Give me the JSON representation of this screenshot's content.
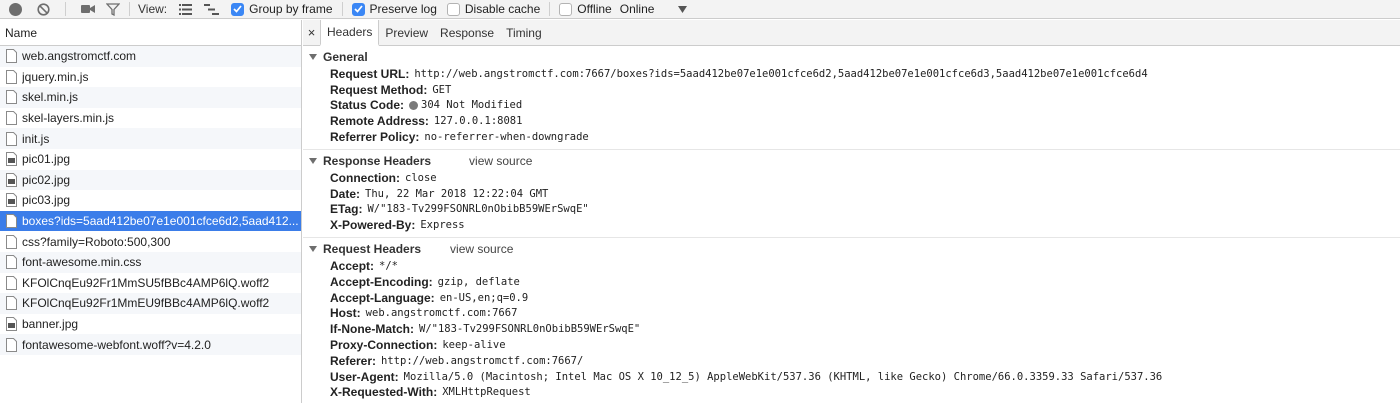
{
  "toolbar": {
    "view_label": "View:",
    "group_by_frame": {
      "label": "Group by frame",
      "checked": true
    },
    "preserve_log": {
      "label": "Preserve log",
      "checked": true
    },
    "disable_cache": {
      "label": "Disable cache",
      "checked": false
    },
    "offline": {
      "label": "Offline",
      "checked": false
    },
    "throttle_value": "Online",
    "icons": [
      "record-icon",
      "clear-icon",
      "camera-icon",
      "filter-icon",
      "list-view-icon",
      "waterfall-view-icon",
      "dropdown-arrow-icon"
    ]
  },
  "request_list": {
    "header": "Name",
    "items": [
      {
        "name": "web.angstromctf.com",
        "icon": "document-icon"
      },
      {
        "name": "jquery.min.js",
        "icon": "document-icon"
      },
      {
        "name": "skel.min.js",
        "icon": "document-icon"
      },
      {
        "name": "skel-layers.min.js",
        "icon": "document-icon"
      },
      {
        "name": "init.js",
        "icon": "document-icon"
      },
      {
        "name": "pic01.jpg",
        "icon": "image-icon"
      },
      {
        "name": "pic02.jpg",
        "icon": "image-icon"
      },
      {
        "name": "pic03.jpg",
        "icon": "image-icon"
      },
      {
        "name": "boxes?ids=5aad412be07e1e001cfce6d2,5aad412...",
        "icon": "document-icon",
        "selected": true
      },
      {
        "name": "css?family=Roboto:500,300",
        "icon": "document-icon"
      },
      {
        "name": "font-awesome.min.css",
        "icon": "document-icon"
      },
      {
        "name": "KFOlCnqEu92Fr1MmSU5fBBc4AMP6lQ.woff2",
        "icon": "document-icon"
      },
      {
        "name": "KFOlCnqEu92Fr1MmEU9fBBc4AMP6lQ.woff2",
        "icon": "document-icon"
      },
      {
        "name": "banner.jpg",
        "icon": "image-icon"
      },
      {
        "name": "fontawesome-webfont.woff?v=4.2.0",
        "icon": "document-icon"
      }
    ]
  },
  "detail": {
    "close_glyph": "×",
    "tabs": [
      "Headers",
      "Preview",
      "Response",
      "Timing"
    ],
    "active_tab": "Headers",
    "general": {
      "title": "General",
      "request_url_key": "Request URL:",
      "request_url": "http://web.angstromctf.com:7667/boxes?ids=5aad412be07e1e001cfce6d2,5aad412be07e1e001cfce6d3,5aad412be07e1e001cfce6d4",
      "method_key": "Request Method:",
      "method": "GET",
      "status_key": "Status Code:",
      "status": "304 Not Modified",
      "remote_key": "Remote Address:",
      "remote": "127.0.0.1:8081",
      "referrer_policy_key": "Referrer Policy:",
      "referrer_policy": "no-referrer-when-downgrade"
    },
    "response_headers": {
      "title": "Response Headers",
      "view_source": "view source",
      "rows": [
        {
          "key": "Connection:",
          "value": "close"
        },
        {
          "key": "Date:",
          "value": "Thu, 22 Mar 2018 12:22:04 GMT"
        },
        {
          "key": "ETag:",
          "value": "W/\"183-Tv299FSONRL0nObibB59WErSwqE\""
        },
        {
          "key": "X-Powered-By:",
          "value": "Express"
        }
      ]
    },
    "request_headers": {
      "title": "Request Headers",
      "view_source": "view source",
      "rows": [
        {
          "key": "Accept:",
          "value": "*/*"
        },
        {
          "key": "Accept-Encoding:",
          "value": "gzip, deflate"
        },
        {
          "key": "Accept-Language:",
          "value": "en-US,en;q=0.9"
        },
        {
          "key": "Host:",
          "value": "web.angstromctf.com:7667"
        },
        {
          "key": "If-None-Match:",
          "value": "W/\"183-Tv299FSONRL0nObibB59WErSwqE\""
        },
        {
          "key": "Proxy-Connection:",
          "value": "keep-alive"
        },
        {
          "key": "Referer:",
          "value": "http://web.angstromctf.com:7667/"
        },
        {
          "key": "User-Agent:",
          "value": "Mozilla/5.0 (Macintosh; Intel Mac OS X 10_12_5) AppleWebKit/537.36 (KHTML, like Gecko) Chrome/66.0.3359.33 Safari/537.36"
        },
        {
          "key": "X-Requested-With:",
          "value": "XMLHttpRequest"
        }
      ]
    }
  }
}
